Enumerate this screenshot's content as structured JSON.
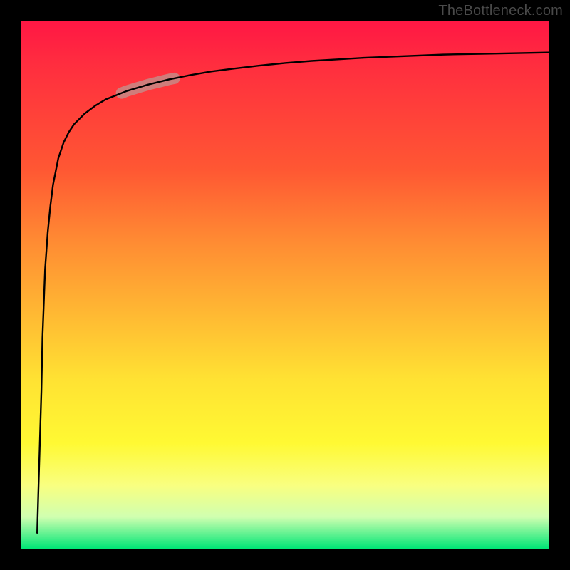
{
  "attribution": "TheBottleneck.com",
  "chart_data": {
    "type": "line",
    "title": "",
    "xlabel": "",
    "ylabel": "",
    "xlim": [
      0,
      100
    ],
    "ylim": [
      0,
      100
    ],
    "background_gradient": {
      "top": "#ff1744",
      "mid1": "#ff8c33",
      "mid2": "#fff933",
      "bottom": "#00e676"
    },
    "curve_color": "#000000",
    "highlight": {
      "color": "#c78a86",
      "x_range": [
        19,
        29
      ],
      "y_range": [
        80,
        87
      ]
    },
    "series": [
      {
        "name": "bottleneck-curve",
        "x": [
          3.0,
          3.2,
          3.5,
          3.8,
          4.0,
          4.5,
          5.0,
          5.5,
          6.0,
          7.0,
          8.0,
          9.0,
          10.0,
          12.0,
          14.0,
          16.0,
          18.0,
          20.0,
          24.0,
          28.0,
          32.0,
          36.0,
          40.0,
          45.0,
          50.0,
          55.0,
          60.0,
          65.0,
          70.0,
          80.0,
          90.0,
          100.0
        ],
        "values": [
          3.0,
          10.0,
          20.0,
          30.0,
          40.0,
          53.0,
          60.0,
          65.0,
          69.0,
          74.0,
          77.0,
          79.0,
          80.5,
          82.5,
          84.0,
          85.2,
          86.0,
          86.8,
          88.0,
          89.0,
          89.8,
          90.5,
          91.0,
          91.6,
          92.1,
          92.5,
          92.8,
          93.1,
          93.3,
          93.7,
          93.9,
          94.1
        ]
      }
    ]
  }
}
